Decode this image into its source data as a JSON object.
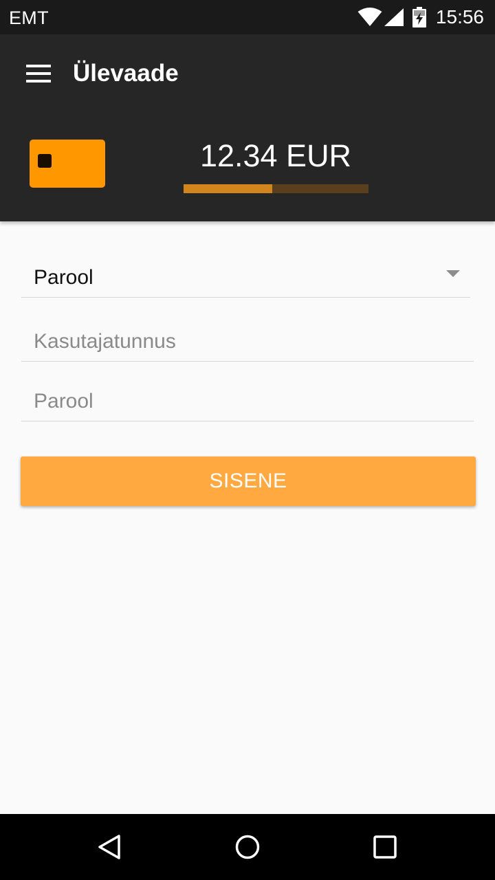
{
  "status_bar": {
    "carrier": "EMT",
    "time": "15:56",
    "icons": [
      "wifi-icon",
      "signal-icon",
      "battery-charging-icon"
    ]
  },
  "toolbar": {
    "menu_icon": "hamburger-menu-icon",
    "title": "Ülevaade"
  },
  "balance": {
    "card_icon": "card-icon",
    "amount": "12.34 EUR",
    "progress_fraction": 0.48
  },
  "form": {
    "login_method": "Parool",
    "username": {
      "value": "",
      "placeholder": "Kasutajatunnus"
    },
    "password": {
      "value": "",
      "placeholder": "Parool"
    },
    "submit_label": "SISENE"
  },
  "nav_bar": {
    "icons": [
      "back-icon",
      "home-icon",
      "recents-icon"
    ]
  },
  "colors": {
    "accent": "#ffa940",
    "card": "#ff9800",
    "toolbar": "#262626",
    "status_bar": "#1a1a1a",
    "progress_track": "#5a3f1e",
    "progress_fill": "#d1851c"
  }
}
